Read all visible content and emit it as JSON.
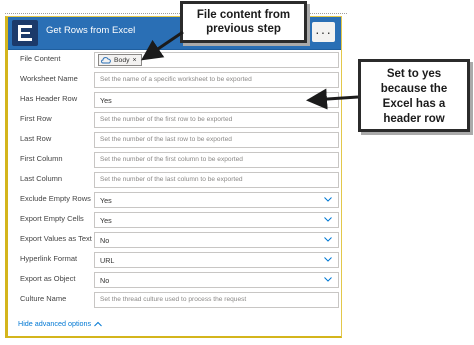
{
  "card": {
    "title": "Get Rows from Excel",
    "more": "···",
    "brand_color": "#2a6fb5",
    "border_color": "#d4b51c"
  },
  "fields": [
    {
      "label": "File Content",
      "token": "Body",
      "token_remove": "×"
    },
    {
      "label": "Worksheet Name",
      "placeholder": "Set the name of a specific worksheet to be exported"
    },
    {
      "label": "Has Header Row",
      "value": "Yes"
    },
    {
      "label": "First Row",
      "placeholder": "Set the number of the first row to be exported"
    },
    {
      "label": "Last Row",
      "placeholder": "Set the number of the last row to be exported"
    },
    {
      "label": "First Column",
      "placeholder": "Set the number of the first column to be exported"
    },
    {
      "label": "Last Column",
      "placeholder": "Set the number of the last column to be exported"
    },
    {
      "label": "Exclude Empty Rows",
      "value": "Yes",
      "dropdown": true
    },
    {
      "label": "Export Empty Cells",
      "value": "Yes",
      "dropdown": true
    },
    {
      "label": "Export Values as Text",
      "value": "No",
      "dropdown": true
    },
    {
      "label": "Hyperlink Format",
      "value": "URL",
      "dropdown": true
    },
    {
      "label": "Export as Object",
      "value": "No",
      "dropdown": true
    },
    {
      "label": "Culture Name",
      "placeholder": "Set the thread culture used to process the request"
    }
  ],
  "advanced": {
    "label": "Hide advanced options",
    "icon": "chevron-up-icon"
  },
  "callouts": {
    "file_content": {
      "line1": "File content from",
      "line2": "previous step"
    },
    "header_row": {
      "line1": "Set to yes",
      "line2": "because the",
      "line3": "Excel has a",
      "line4": "header row"
    }
  }
}
